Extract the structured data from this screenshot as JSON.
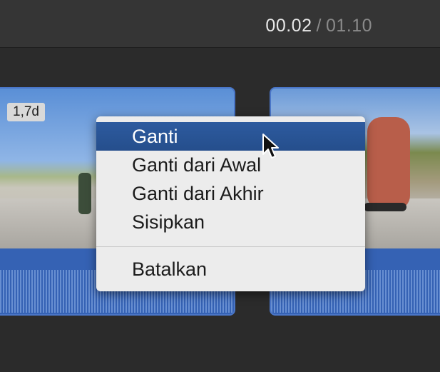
{
  "timecode": {
    "current": "00.02",
    "separator": "/",
    "total": "01.10"
  },
  "clip_left": {
    "duration_badge": "1,7d"
  },
  "context_menu": {
    "items": [
      {
        "label": "Ganti"
      },
      {
        "label": "Ganti dari Awal"
      },
      {
        "label": "Ganti dari Akhir"
      },
      {
        "label": "Sisipkan"
      },
      {
        "label": "Batalkan"
      }
    ],
    "selected_item": "Ganti"
  },
  "colors": {
    "accent": "#2d5b9f",
    "clip": "#3a66b8",
    "background": "#2b2b2b"
  },
  "icons": {
    "cursor": "arrow-cursor-icon"
  }
}
